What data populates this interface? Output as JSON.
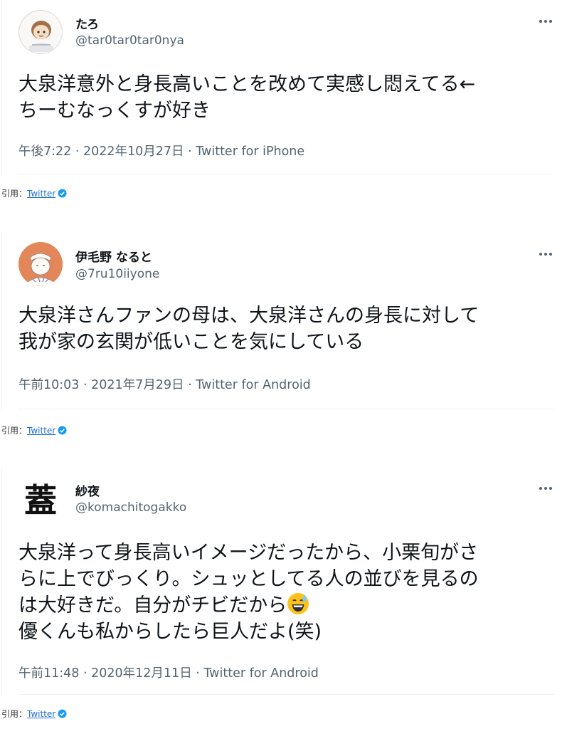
{
  "tweets": [
    {
      "display_name": "たろ",
      "handle": "@tar0tar0tar0nya",
      "text_lines": [
        "大泉洋意外と身長高いことを改めて実感し悶えてる←",
        "ちーむなっくすが好き"
      ],
      "meta": "午後7:22 · 2022年10月27日 · Twitter for iPhone",
      "quote_label": "引用：",
      "quote_link": "Twitter"
    },
    {
      "display_name": "伊毛野 なると",
      "handle": "@7ru10iiyone",
      "text_lines": [
        "大泉洋さんファンの母は、大泉洋さんの身長に対して",
        "我が家の玄関が低いことを気にしている"
      ],
      "meta": "午前10:03 · 2021年7月29日 · Twitter for Android",
      "quote_label": "引用：",
      "quote_link": "Twitter"
    },
    {
      "display_name": "紗夜",
      "handle": "@komachitogakko",
      "avatar_glyph": "蓋",
      "text_lines": [
        "大泉洋って身長高いイメージだったから、小栗旬がさ",
        "らに上でびっくり。シュッとしてる人の並びを見るの",
        "は大好きだ。自分がチビだから",
        "優くんも私からしたら巨人だよ(笑)"
      ],
      "emoji": "grinning-sweat-emoji",
      "meta": "午前11:48 · 2020年12月11日 · Twitter for Android",
      "quote_label": "引用：",
      "quote_link": "Twitter"
    }
  ],
  "colors": {
    "text": "#0f1419",
    "secondary": "#536471",
    "link": "#1d6fd6",
    "divider": "#eff3f4",
    "verified": "#1d9bf0"
  }
}
